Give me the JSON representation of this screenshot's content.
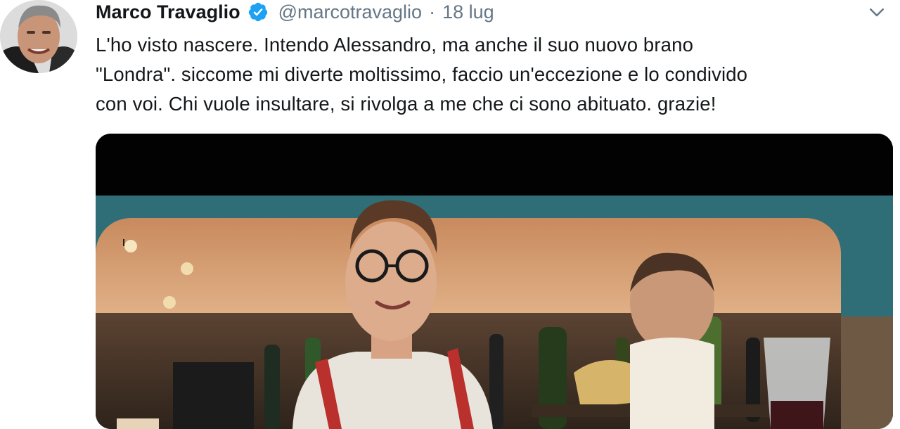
{
  "tweet": {
    "author_name": "Marco Travaglio",
    "author_handle": "@marcotravaglio",
    "separator": "·",
    "date": "18 lug",
    "verified": true,
    "text_lines": [
      "L'ho visto nascere. Intendo Alessandro, ma anche il suo nuovo brano",
      "\"Londra\". siccome mi diverte moltissimo, faccio un'eccezione e lo condivido",
      "con voi. Chi vuole insultare, si rivolga a me che ci sono abituato. grazie!"
    ]
  },
  "icons": {
    "verified": "verified-badge-icon",
    "menu": "chevron-down-icon"
  },
  "colors": {
    "verified_blue": "#1da1f2",
    "secondary_text": "#657786",
    "primary_text": "#14171a"
  }
}
